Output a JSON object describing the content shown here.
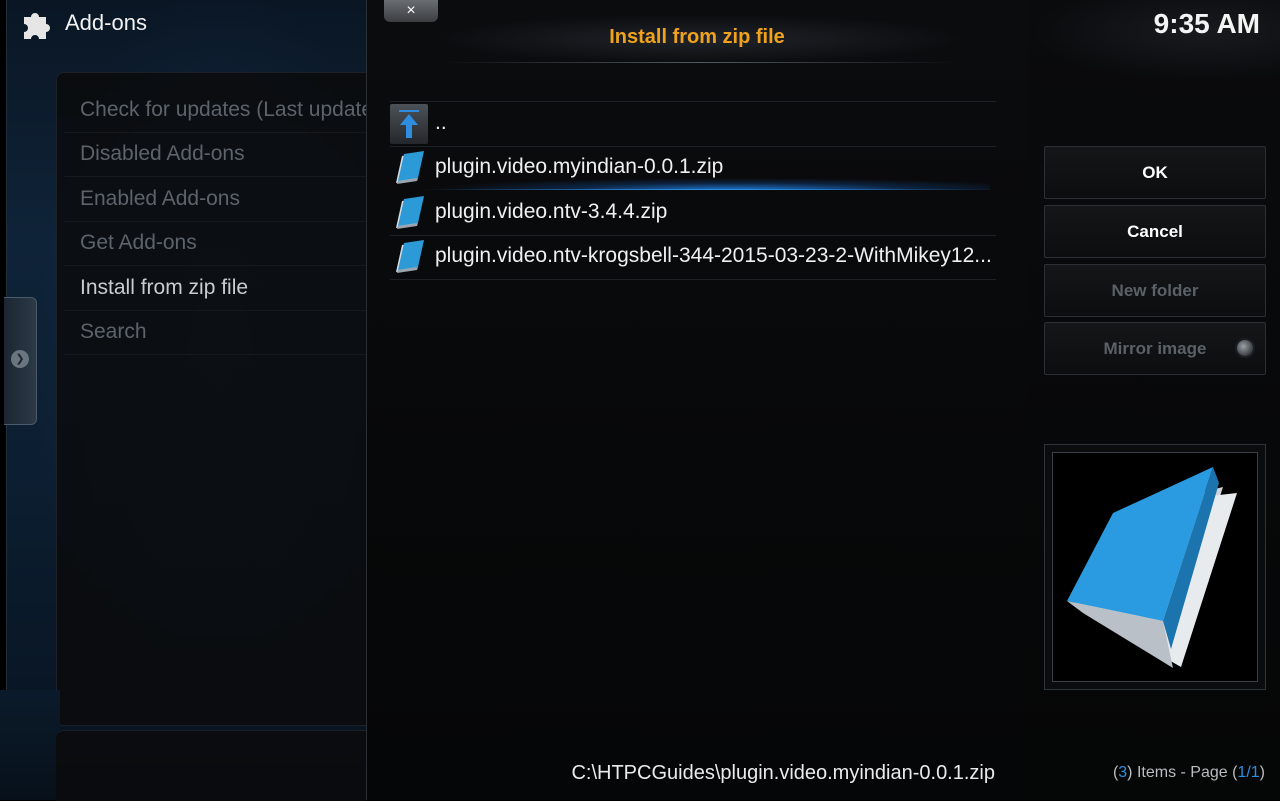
{
  "header": {
    "title": "Add-ons",
    "icon": "puzzle-piece-icon"
  },
  "sidebar": {
    "items": [
      {
        "label": "Check for updates (Last updated"
      },
      {
        "label": "Disabled Add-ons"
      },
      {
        "label": "Enabled Add-ons"
      },
      {
        "label": "Get Add-ons"
      },
      {
        "label": "Install from zip file"
      },
      {
        "label": "Search"
      }
    ],
    "active_index": 4
  },
  "dialog": {
    "title": "Install from zip file",
    "close_label": "×",
    "files": [
      {
        "label": "..",
        "icon": "parent-folder-up-arrow-icon"
      },
      {
        "label": "plugin.video.myindian-0.0.1.zip",
        "icon": "zip-file-icon",
        "focused": true
      },
      {
        "label": "plugin.video.ntv-3.4.4.zip",
        "icon": "zip-file-icon"
      },
      {
        "label": "plugin.video.ntv-krogsbell-344-2015-03-23-2-WithMikey12...",
        "icon": "zip-file-icon"
      }
    ],
    "selected_path": "C:\\HTPCGuides\\plugin.video.myindian-0.0.1.zip"
  },
  "right": {
    "clock": "9:35 AM",
    "buttons": {
      "ok": "OK",
      "cancel": "Cancel",
      "new_folder": "New folder",
      "mirror_image": "Mirror image"
    },
    "footer": {
      "open_paren": "(",
      "count": "3",
      "mid": ") Items - Page (",
      "page": "1/1",
      "close_paren": ")"
    }
  },
  "colors": {
    "title_accent": "#f0a21c",
    "focus_blue": "#2f8de0",
    "disabled_text": "#5b6168"
  }
}
